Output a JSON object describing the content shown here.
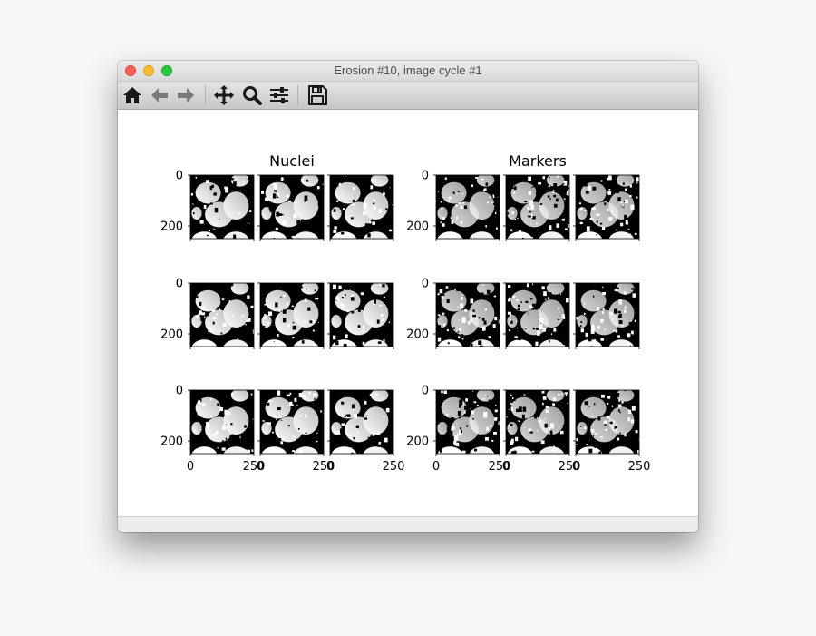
{
  "window": {
    "title": "Erosion #10, image cycle #1"
  },
  "toolbar": {
    "tools": [
      {
        "name": "home",
        "icon": "home-icon"
      },
      {
        "name": "back",
        "icon": "arrow-left-icon"
      },
      {
        "name": "forward",
        "icon": "arrow-right-icon"
      },
      {
        "name": "pan",
        "icon": "move-icon"
      },
      {
        "name": "zoom",
        "icon": "magnifier-icon"
      },
      {
        "name": "configure",
        "icon": "sliders-icon"
      },
      {
        "name": "save",
        "icon": "floppy-disk-icon"
      }
    ]
  },
  "chart_data": {
    "type": "image-grid",
    "rows": 3,
    "panels": [
      {
        "title": "Nuclei",
        "columns": 3,
        "ytick_labels": [
          "0",
          "200"
        ],
        "xtick_labels": [
          "0",
          "250"
        ]
      },
      {
        "title": "Markers",
        "columns": 3,
        "ytick_labels": [
          "0",
          "200"
        ],
        "xtick_labels": [
          "0",
          "250"
        ]
      }
    ]
  }
}
